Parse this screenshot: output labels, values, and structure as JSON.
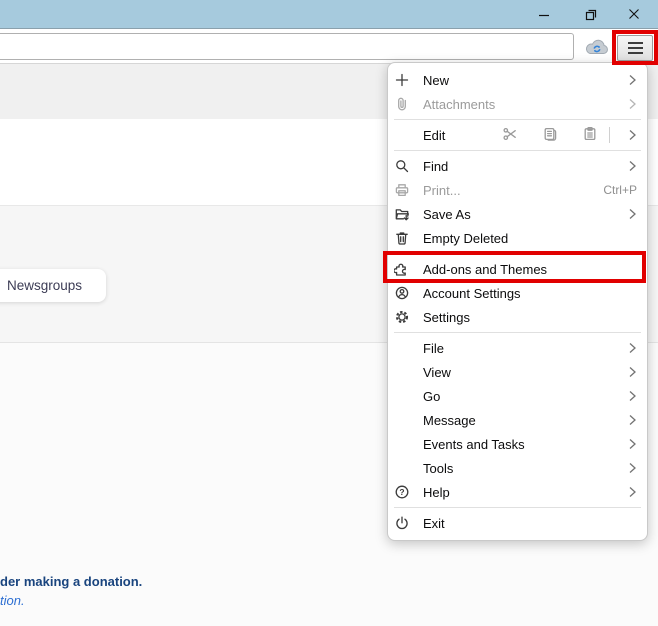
{
  "window": {
    "controls": {
      "minimize": "minimize",
      "restore": "restore-window",
      "close": "close"
    }
  },
  "toolbar": {
    "search": {
      "value": "",
      "placeholder": ""
    },
    "sync_button": "cloud-sync",
    "menu_button": "app-menu-hamburger"
  },
  "menu": {
    "items": [
      {
        "label": "New",
        "icon": "plus-icon",
        "submenu": true
      },
      {
        "label": "Attachments",
        "icon": "paperclip-icon",
        "submenu": true,
        "disabled": true
      },
      {
        "label": "Edit",
        "icons": [
          "cut-icon",
          "copy-icon",
          "paste-icon"
        ],
        "submenu": true
      },
      {
        "label": "Find",
        "icon": "search-icon",
        "submenu": true
      },
      {
        "label": "Print...",
        "icon": "printer-icon",
        "shortcut": "Ctrl+P",
        "disabled": true
      },
      {
        "label": "Save As",
        "icon": "save-as-icon",
        "submenu": true
      },
      {
        "label": "Empty Deleted",
        "icon": "trash-icon"
      },
      {
        "label": "Add-ons and Themes",
        "icon": "puzzle-icon",
        "highlighted": true
      },
      {
        "label": "Account Settings",
        "icon": "account-icon"
      },
      {
        "label": "Settings",
        "icon": "gear-icon"
      },
      {
        "label": "File",
        "submenu": true
      },
      {
        "label": "View",
        "submenu": true
      },
      {
        "label": "Go",
        "submenu": true
      },
      {
        "label": "Message",
        "submenu": true
      },
      {
        "label": "Events and Tasks",
        "submenu": true
      },
      {
        "label": "Tools",
        "submenu": true
      },
      {
        "label": "Help",
        "icon": "help-icon",
        "submenu": true
      },
      {
        "label": "Exit",
        "icon": "power-icon"
      }
    ]
  },
  "content": {
    "newsgroups_chip": "Newsgroups",
    "donation_text": "der making a donation.",
    "donation_link": "tion."
  },
  "colors": {
    "annotation_highlight": "#e10000",
    "titlebar": "#a6cadd",
    "link_blue": "#2d6fd2",
    "donation_navy": "#19447e"
  }
}
